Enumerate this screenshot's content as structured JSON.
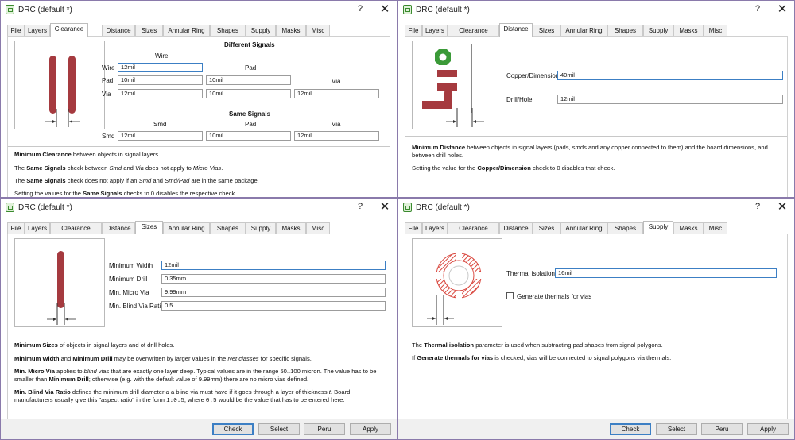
{
  "window_title": "DRC (default *)",
  "help_glyph": "?",
  "close_glyph": "✕",
  "tabs": [
    "File",
    "Layers",
    "Clearance",
    "Distance",
    "Sizes",
    "Annular Ring",
    "Shapes",
    "Supply",
    "Masks",
    "Misc"
  ],
  "buttons": {
    "check": "Check",
    "select": "Select",
    "peru": "Peru",
    "apply": "Apply"
  },
  "clearance": {
    "different_signals": "Different Signals",
    "same_signals": "Same Signals",
    "col_wire": "Wire",
    "col_pad": "Pad",
    "col_via": "Via",
    "col_smd": "Smd",
    "row_wire": "Wire",
    "row_pad": "Pad",
    "row_via": "Via",
    "row_smd": "Smd",
    "wire_wire": "12mil",
    "pad_wire": "10mil",
    "pad_pad": "10mil",
    "via_wire": "12mil",
    "via_pad": "10mil",
    "via_via": "12mil",
    "smd_smd": "12mil",
    "smd_pad": "10mil",
    "smd_via": "12mil",
    "desc1_bold": "Minimum Clearance",
    "desc1_rest": " between objects in signal layers.",
    "desc2_a": "The ",
    "desc2_b": "Same Signals",
    "desc2_c": " check between ",
    "desc2_d": "Smd",
    "desc2_e": " and ",
    "desc2_f": "Via",
    "desc2_g": " does not apply to ",
    "desc2_h": "Micro Vias",
    "desc2_i": ".",
    "desc3_a": "The ",
    "desc3_b": "Same Signals",
    "desc3_c": " check does not apply if an ",
    "desc3_d": "Smd",
    "desc3_e": " and ",
    "desc3_f": "Smd/Pad",
    "desc3_g": " are in the same package.",
    "desc4_a": "Setting the values for the ",
    "desc4_b": "Same Signals",
    "desc4_c": " checks to 0 disables the respective check."
  },
  "distance": {
    "copper_label": "Copper/Dimension",
    "copper_value": "40mil",
    "drill_label": "Drill/Hole",
    "drill_value": "12mil",
    "desc1_bold": "Minimum Distance",
    "desc1_rest": " between objects in signal layers (pads, smds and any copper connected to them) and the board dimensions, and",
    "desc1_line2": "between drill holes.",
    "desc2_a": "Setting the value for the ",
    "desc2_b": "Copper/Dimension",
    "desc2_c": " check to 0 disables that check."
  },
  "sizes": {
    "min_width_label": "Minimum Width",
    "min_width": "12mil",
    "min_drill_label": "Minimum Drill",
    "min_drill": "0.35mm",
    "micro_via_label": "Min. Micro Via",
    "micro_via": "9.99mm",
    "blind_ratio_label": "Min. Blind Via Ratio",
    "blind_ratio": "0.5",
    "d1_a": "Minimum Sizes",
    "d1_b": " of objects in signal layers and of drill holes.",
    "d2_a": "Minimum Width",
    "d2_b": " and ",
    "d2_c": "Minimum Drill",
    "d2_d": " may be overwritten by larger values in the ",
    "d2_e": "Net classes",
    "d2_f": " for specific signals.",
    "d3_a": "Min. Micro Via",
    "d3_b": " applies to ",
    "d3_c": "blind",
    "d3_d": " vias that are exactly one layer deep. Typical values are in the range 50..100 micron. The value has to be",
    "d3_line2_a": "smaller than ",
    "d3_line2_b": "Minimum Drill",
    "d3_line2_c": "; otherwise (e.g. with the default value of 9.99mm) there are no micro vias defined.",
    "d4_a": "Min. Blind Via Ratio",
    "d4_b": " defines the minimum drill diameter ",
    "d4_c": "d",
    "d4_d": " a blind via must have if it goes through a layer of thickness ",
    "d4_e": "t",
    "d4_f": ". Board",
    "d4_line2_a": "manufacturers usually give this \"aspect ratio\" in the form ",
    "d4_line2_b": "1:0.5",
    "d4_line2_c": ", where ",
    "d4_line2_d": "0.5",
    "d4_line2_e": " would be the value that has to be entered here."
  },
  "supply": {
    "thermal_label": "Thermal isolation",
    "thermal_value": "16mil",
    "gen_thermals_label": "Generate thermals for vias",
    "gen_thermals_checked": false,
    "d1_a": "The ",
    "d1_b": "Thermal isolation",
    "d1_c": " parameter is used when subtracting pad shapes from signal polygons.",
    "d2_a": "If ",
    "d2_b": "Generate thermals for vias",
    "d2_c": " is checked, vias will be connected to signal polygons via thermals."
  },
  "colors": {
    "copper": "#a53a3f",
    "via_green": "#3b9a38",
    "thermal": "#d9473e",
    "focus": "#3c7fc4"
  }
}
